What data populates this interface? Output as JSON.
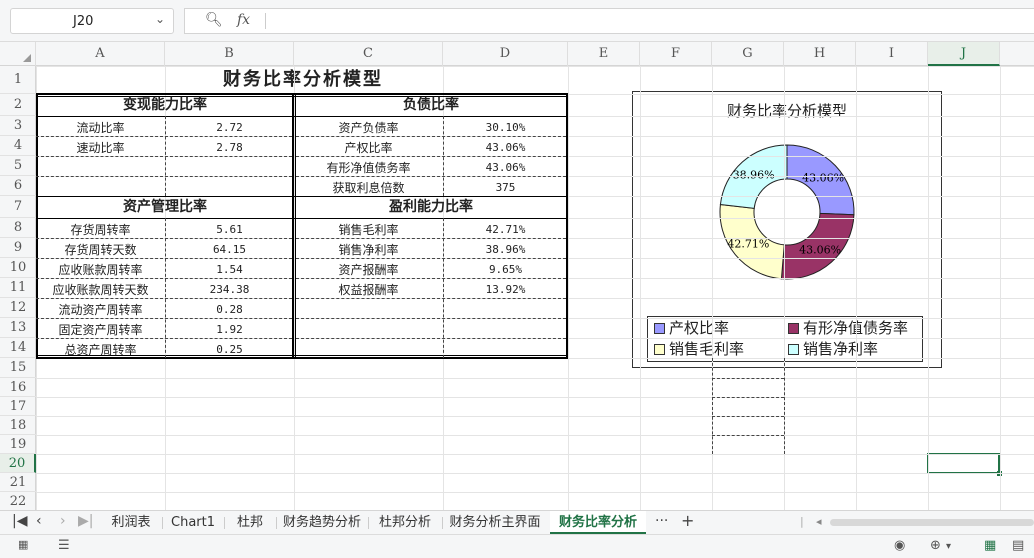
{
  "name_box": {
    "value": "J20"
  },
  "formula": {
    "zoom_icon": "zoom-icon",
    "fx_label": "fx",
    "content": ""
  },
  "columns": [
    "A",
    "B",
    "C",
    "D",
    "E",
    "F",
    "G",
    "H",
    "I",
    "J"
  ],
  "rows": [
    "1",
    "2",
    "3",
    "4",
    "5",
    "6",
    "7",
    "8",
    "9",
    "10",
    "11",
    "12",
    "13",
    "14",
    "15",
    "16",
    "17",
    "18",
    "19",
    "20",
    "21",
    "22"
  ],
  "active_column": "J",
  "active_row": "20",
  "sheet": {
    "title": "财务比率分析模型",
    "sections": {
      "liquidity": "变现能力比率",
      "debt": "负债比率",
      "asset_mgmt": "资产管理比率",
      "profit": "盈利能力比率"
    },
    "liquidity_rows": [
      {
        "label": "流动比率",
        "value": "2.72"
      },
      {
        "label": "速动比率",
        "value": "2.78"
      }
    ],
    "debt_rows": [
      {
        "label": "资产负债率",
        "value": "30.10%"
      },
      {
        "label": "产权比率",
        "value": "43.06%"
      },
      {
        "label": "有形净值债务率",
        "value": "43.06%"
      },
      {
        "label": "获取利息倍数",
        "value": "375"
      }
    ],
    "asset_rows": [
      {
        "label": "存货周转率",
        "value": "5.61"
      },
      {
        "label": "存货周转天数",
        "value": "64.15"
      },
      {
        "label": "应收账款周转率",
        "value": "1.54"
      },
      {
        "label": "应收账款周转天数",
        "value": "234.38"
      },
      {
        "label": "流动资产周转率",
        "value": "0.28"
      },
      {
        "label": "固定资产周转率",
        "value": "1.92"
      },
      {
        "label": "总资产周转率",
        "value": "0.25"
      }
    ],
    "profit_rows": [
      {
        "label": "销售毛利率",
        "value": "42.71%"
      },
      {
        "label": "销售净利率",
        "value": "38.96%"
      },
      {
        "label": "资产报酬率",
        "value": "9.65%"
      },
      {
        "label": "权益报酬率",
        "value": "13.92%"
      }
    ]
  },
  "chart_data": {
    "type": "pie",
    "title": "财务比率分析模型",
    "donut": true,
    "legend": "bottom",
    "categories": [
      "产权比率",
      "有形净值债务率",
      "销售毛利率",
      "销售净利率"
    ],
    "values": [
      43.06,
      43.06,
      42.71,
      38.96
    ],
    "labels": [
      "43.06%",
      "43.06%",
      "42.71%",
      "38.96%"
    ],
    "colors": [
      "#9999ff",
      "#993366",
      "#ffffcc",
      "#ccffff"
    ]
  },
  "tabs": {
    "items": [
      "利润表",
      "Chart1",
      "杜邦",
      "财务趋势分析",
      "杜邦分析",
      "财务分析主界面",
      "财务比率分析"
    ],
    "active": "财务比率分析",
    "more": "···",
    "add": "+"
  },
  "status": {}
}
